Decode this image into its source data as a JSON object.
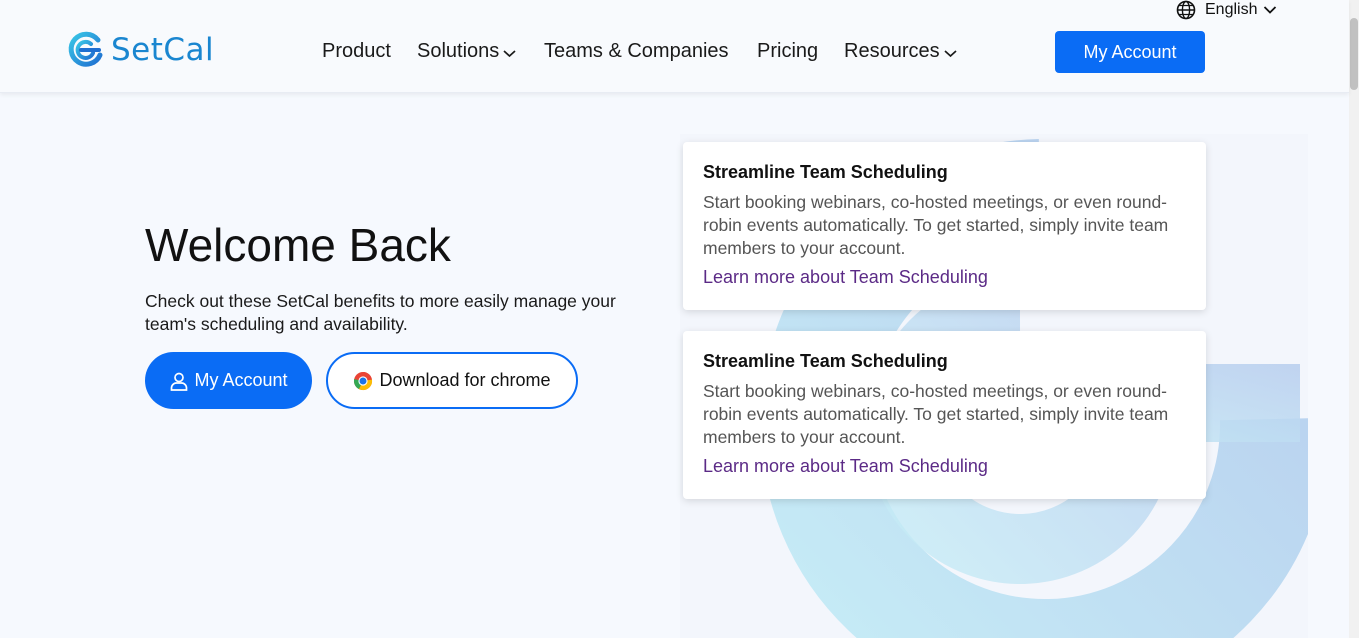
{
  "header": {
    "logo_text": "SetCal",
    "language": "English",
    "nav": [
      {
        "label": "Product",
        "dropdown": false
      },
      {
        "label": "Solutions",
        "dropdown": true
      },
      {
        "label": "Teams & Companies",
        "dropdown": false
      },
      {
        "label": "Pricing",
        "dropdown": false
      },
      {
        "label": "Resources",
        "dropdown": true
      }
    ],
    "account_button": "My Account"
  },
  "hero": {
    "title": "Welcome Back",
    "subtitle": "Check out these SetCal benefits to more easily manage your team's scheduling and availability.",
    "primary_button": "My Account",
    "secondary_button": "Download for chrome"
  },
  "cards": [
    {
      "title": "Streamline Team Scheduling",
      "body": "Start booking webinars, co-hosted meetings, or even round-robin events automatically. To get started, simply invite team members to your account.",
      "link": "Learn more about Team Scheduling"
    },
    {
      "title": "Streamline Team Scheduling",
      "body": "Start booking webinars, co-hosted meetings, or even round-robin events automatically. To get started, simply invite team members to your account.",
      "link": "Learn more about Team Scheduling"
    }
  ],
  "colors": {
    "brand_blue": "#0a6cf5",
    "logo_blue": "#1a86d0",
    "link_purple": "#5b2a86",
    "page_bg": "#f6f9fe"
  },
  "icons": {
    "language": "globe-icon",
    "dropdown": "chevron-down-icon",
    "account": "user-icon",
    "download": "chrome-icon",
    "logo": "setcal-logo-icon"
  }
}
